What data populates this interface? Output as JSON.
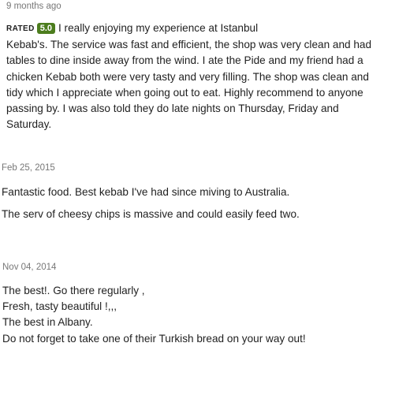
{
  "reviews": [
    {
      "date": "9 months ago",
      "rated_label": "RATED",
      "rating": "5.0",
      "lines": [
        "I really enjoying my experience at Istanbul",
        "Kebab's. The service was fast and efficient, the shop was very clean and had",
        "tables to dine inside away from the wind. I ate the Pide and my friend had a",
        "chicken Kebab both were very tasty and very filling. The shop was clean and",
        "tidy which I appreciate when going out to eat. Highly recommend to anyone",
        "passing by. I was also told they do late nights on Thursday, Friday and",
        "Saturday."
      ]
    },
    {
      "date": "Feb 25, 2015",
      "lines": [
        "Fantastic food. Best kebab I've had since miving to Australia.",
        "The serv of cheesy chips is massive and could easily feed two."
      ]
    },
    {
      "date": "Nov 04, 2014",
      "lines": [
        "The best!. Go there regularly ,",
        "Fresh, tasty beautiful !,,,",
        "The best in Albany.",
        "Do not forget to take one of their Turkish bread on your way out!"
      ]
    }
  ]
}
